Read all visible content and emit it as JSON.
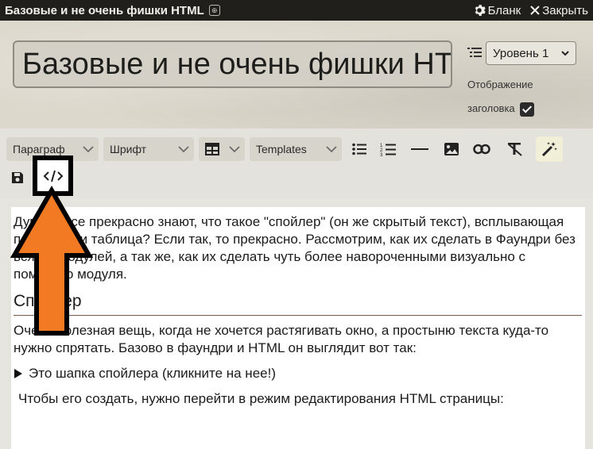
{
  "window": {
    "title": "Базовые и не очень фишки HTML",
    "badge_icon": "globe-icon",
    "sheet_button": "Бланк",
    "close_button": "Закрыть"
  },
  "header": {
    "title_value": "Базовые и не очень фишки HTML",
    "level_select": "Уровень 1",
    "display_label_line1": "Отображение",
    "display_label_line2": "заголовка",
    "display_checked": true
  },
  "toolbar": {
    "paragraph": "Параграф",
    "font": "Шрифт",
    "templates": "Templates",
    "icons": [
      "table-icon",
      "bullet-list-icon",
      "numbered-list-icon",
      "horizontal-rule-icon",
      "image-icon",
      "link-icon",
      "clear-format-icon",
      "magic-wand-icon",
      "save-icon",
      "source-code-icon"
    ]
  },
  "content": {
    "p1": "Думаю, все прекрасно знают, что такое \"спойлер\" (он же скрытый текст), всплывающая подсказка и таблица? Если так, то прекрасно. Рассмотрим, как их сделать в Фаундри без всяких модулей, а так же, как их сделать чуть более навороченными визуально с помощью модуля.",
    "heading": "Спойлер",
    "p2": "Очень полезная вещь, когда не хочется растягивать окно, а простыню текста куда-то нужно спрятать. Базово в фаундри и HTML он выглядит вот так:",
    "spoiler_summary": "Это шапка спойлера (кликните на нее!)",
    "p3": "Чтобы его создать, нужно перейти в режим редактирования HTML страницы:"
  },
  "colors": {
    "titlebar": "#201f1c",
    "arrow_fill": "#f27a22",
    "arrow_outline": "#000000",
    "highlight_box": "#000000"
  }
}
